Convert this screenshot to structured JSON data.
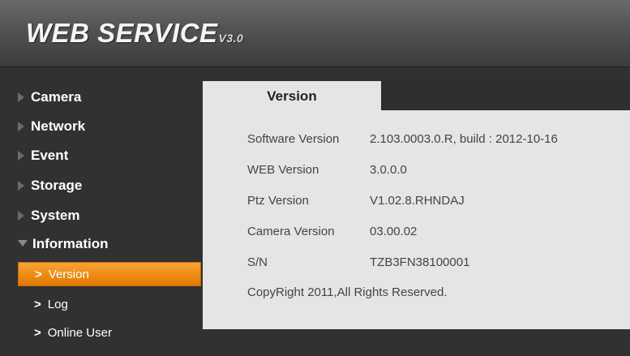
{
  "header": {
    "logo_text": "WEB  SERVICE",
    "logo_version": "V3.0"
  },
  "sidebar": {
    "items": [
      {
        "label": "Camera"
      },
      {
        "label": "Network"
      },
      {
        "label": "Event"
      },
      {
        "label": "Storage"
      },
      {
        "label": "System"
      },
      {
        "label": "Information",
        "expanded": true
      }
    ],
    "subitems": [
      {
        "label": "Version",
        "active": true
      },
      {
        "label": "Log"
      },
      {
        "label": "Online User"
      }
    ]
  },
  "tab": {
    "label": "Version"
  },
  "version_info": {
    "rows": [
      {
        "label": "Software Version",
        "value": "2.103.0003.0.R, build : 2012-10-16"
      },
      {
        "label": "WEB Version",
        "value": "3.0.0.0"
      },
      {
        "label": "Ptz Version",
        "value": "V1.02.8.RHNDAJ"
      },
      {
        "label": "Camera Version",
        "value": "03.00.02"
      },
      {
        "label": "S/N",
        "value": "TZB3FN38100001"
      }
    ],
    "copyright": "CopyRight 2011,All Rights Reserved."
  },
  "colors": {
    "accent": "#ee8a12",
    "background": "#2e2e2e",
    "panel": "#e5e5e5"
  }
}
